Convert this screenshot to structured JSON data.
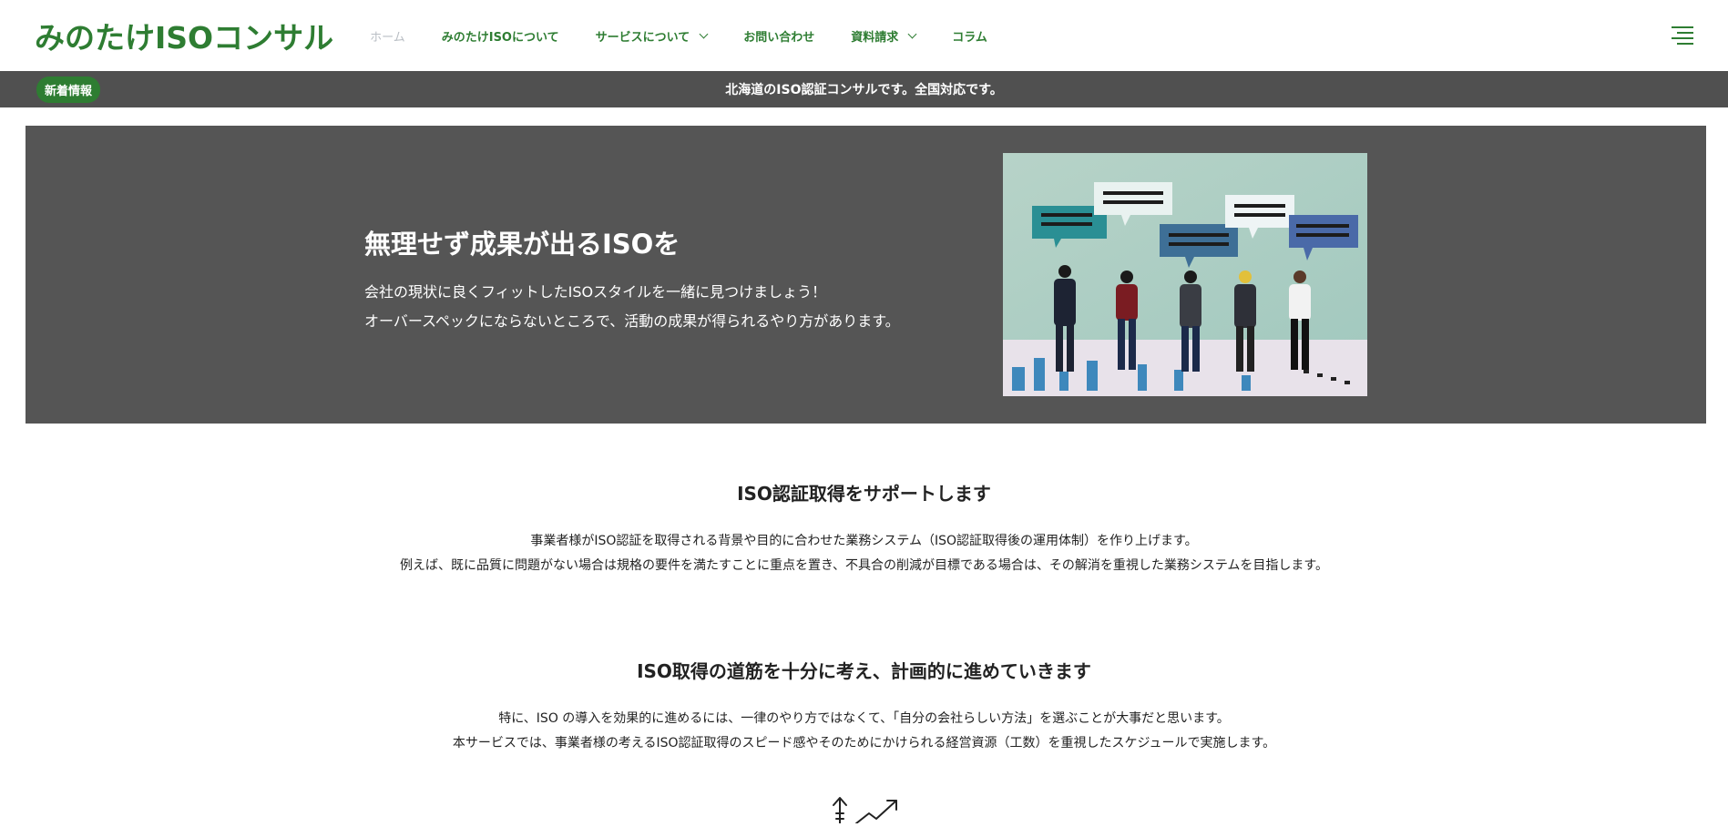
{
  "header": {
    "logo": "みのたけISOコンサル",
    "nav": [
      {
        "label": "ホーム",
        "active": true,
        "dropdown": false
      },
      {
        "label": "みのたけISOについて",
        "active": false,
        "dropdown": false
      },
      {
        "label": "サービスについて",
        "active": false,
        "dropdown": true
      },
      {
        "label": "お問い合わせ",
        "active": false,
        "dropdown": false
      },
      {
        "label": "資料請求",
        "active": false,
        "dropdown": true
      },
      {
        "label": "コラム",
        "active": false,
        "dropdown": false
      }
    ]
  },
  "news": {
    "badge": "新着情報",
    "text": "北海道のISO認証コンサルです。全国対応です。"
  },
  "hero": {
    "title": "無理せず成果が出るISOを",
    "line1": "会社の現状に良くフィットしたISOスタイルを一緒に見つけましょう！",
    "line2": "オーバースペックにならないところで、活動の成果が得られるやり方があります。"
  },
  "section1": {
    "title": "ISO認証取得をサポートします",
    "line1": "事業者様がISO認証を取得される背景や目的に合わせた業務システム（ISO認証取得後の運用体制）を作り上げます。",
    "line2": "例えば、既に品質に問題がない場合は規格の要件を満たすことに重点を置き、不具合の削減が目標である場合は、その解消を重視した業務システムを目指します。"
  },
  "section2": {
    "title": "ISO取得の道筋を十分に考え、計画的に進めていきます",
    "line1": "特に、ISO の導入を効果的に進めるには、一律のやり方ではなくて、「自分の会社らしい方法」を選ぶことが大事だと思います。",
    "line2": "本サービスでは、事業者様の考えるISO認証取得のスピード感やそのためにかけられる経営資源（工数）を重視したスケジュールで実施します。"
  },
  "colors": {
    "brand": "#2e7d32",
    "dark_band": "#505050",
    "hero_bg": "#555555",
    "nav_active": "#b9bec4"
  },
  "icons": [
    "menu-icon",
    "chevron-down-icon",
    "growth-arrows-icon"
  ]
}
